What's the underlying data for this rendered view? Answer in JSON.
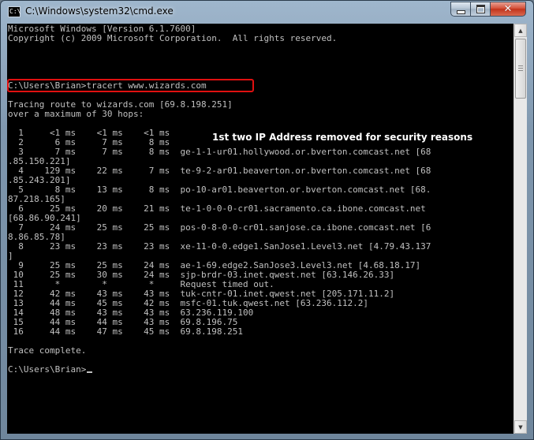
{
  "window": {
    "title": "C:\\Windows\\system32\\cmd.exe",
    "icon": "cmd-icon",
    "icon_text": "C:\\",
    "controls": {
      "minimize_icon": "minimize-icon",
      "maximize_icon": "maximize-icon",
      "close_icon": "close-icon",
      "close_glyph": "✕"
    }
  },
  "console": {
    "lines": [
      "Microsoft Windows [Version 6.1.7600]",
      "Copyright (c) 2009 Microsoft Corporation.  All rights reserved.",
      "",
      "",
      "",
      "",
      "C:\\Users\\Brian>tracert www.wizards.com",
      "",
      "Tracing route to wizards.com [69.8.198.251]",
      "over a maximum of 30 hops:",
      "",
      "  1     <1 ms    <1 ms    <1 ms",
      "  2      6 ms     7 ms     8 ms",
      "  3      7 ms     7 ms     8 ms  ge-1-1-ur01.hollywood.or.bverton.comcast.net [68",
      ".85.150.221]",
      "  4    129 ms    22 ms     7 ms  te-9-2-ar01.beaverton.or.bverton.comcast.net [68",
      ".85.243.201]",
      "  5      8 ms    13 ms     8 ms  po-10-ar01.beaverton.or.bverton.comcast.net [68.",
      "87.218.165]",
      "  6     25 ms    20 ms    21 ms  te-1-0-0-0-cr01.sacramento.ca.ibone.comcast.net",
      "[68.86.90.241]",
      "  7     24 ms    25 ms    25 ms  pos-0-8-0-0-cr01.sanjose.ca.ibone.comcast.net [6",
      "8.86.85.78]",
      "  8     23 ms    23 ms    23 ms  xe-11-0-0.edge1.SanJose1.Level3.net [4.79.43.137",
      "]",
      "  9     25 ms    25 ms    24 ms  ae-1-69.edge2.SanJose3.Level3.net [4.68.18.17]",
      " 10     25 ms    30 ms    24 ms  sjp-brdr-03.inet.qwest.net [63.146.26.33]",
      " 11      *        *        *     Request timed out.",
      " 12     42 ms    43 ms    43 ms  tuk-cntr-01.inet.qwest.net [205.171.11.2]",
      " 13     44 ms    45 ms    42 ms  msfc-01.tuk.qwest.net [63.236.112.2]",
      " 14     48 ms    43 ms    43 ms  63.236.119.100",
      " 15     44 ms    44 ms    43 ms  69.8.196.75",
      " 16     44 ms    47 ms    45 ms  69.8.198.251",
      "",
      "Trace complete.",
      "",
      "C:\\Users\\Brian>"
    ],
    "annotation": "1st two IP Address removed for security reasons"
  },
  "scrollbar": {
    "up_icon": "scroll-up-arrow-icon",
    "down_icon": "scroll-down-arrow-icon",
    "up_glyph": "▲",
    "down_glyph": "▼"
  },
  "colors": {
    "console_bg": "#000000",
    "console_text": "#c0c0c0",
    "highlight": "#e01010",
    "annotation_text": "#ffffff"
  }
}
